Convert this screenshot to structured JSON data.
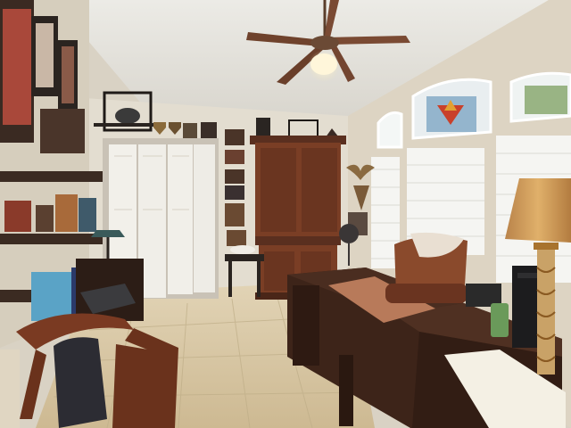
{
  "photo": {
    "subject": "home-office",
    "colors": {
      "ceiling": "#e6e4de",
      "wall_left": "#e0d9cc",
      "wall_right": "#dcd3c3",
      "floor": "#d9c9a8",
      "wood_dark": "#5a2f1f",
      "wood_medium": "#7a3e25",
      "desk": "#3d2419",
      "closet_doors": "#f1efea",
      "window_light": "#f4f7f6",
      "stained_glass_red": "#c9402a",
      "stained_glass_blue": "#5b8fb5",
      "lampshade": "#c89a5a",
      "leather_chair": "#8a4a2c"
    }
  }
}
